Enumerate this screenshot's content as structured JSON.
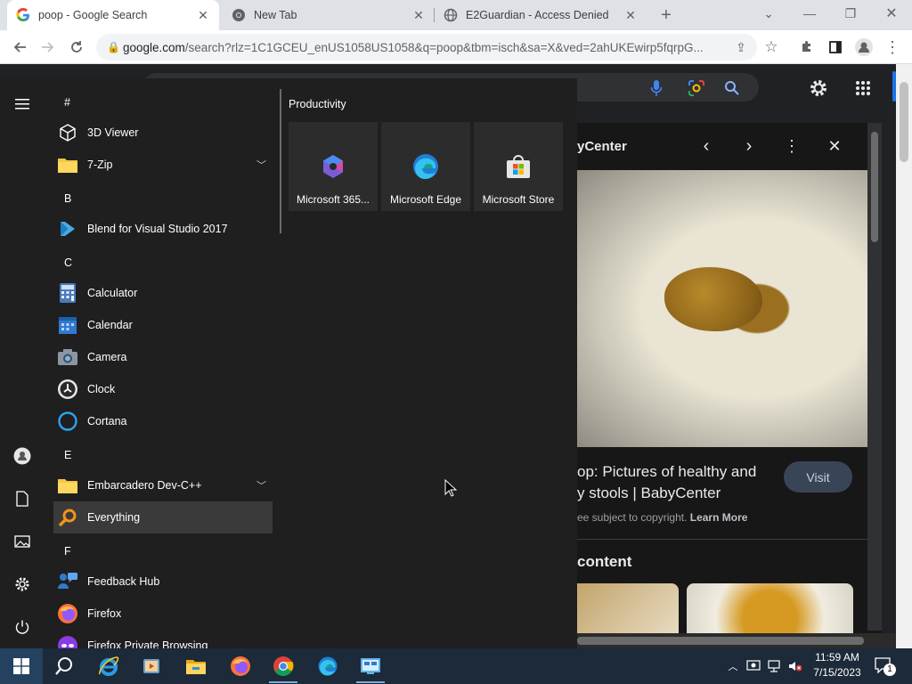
{
  "browser": {
    "tabs": [
      {
        "title": "poop - Google Search",
        "active": true,
        "icon": "google-icon"
      },
      {
        "title": "New Tab",
        "active": false,
        "icon": "chrome-icon"
      },
      {
        "title": "E2Guardian - Access Denied",
        "active": false,
        "icon": "globe-icon"
      }
    ],
    "new_tab_symbol": "+",
    "address": {
      "host": "google.com",
      "path": "/search?rlz=1C1GCEU_enUS1058US1058&q=poop&tbm=isch&sa=X&ved=2ahUKEwirp5fqrpG..."
    }
  },
  "google": {
    "preview": {
      "source": "yCenter",
      "title_line1": "op: Pictures of healthy and",
      "title_line2": "y stools | BabyCenter",
      "visit_label": "Visit",
      "copyright": "ee subject to copyright.",
      "learn_more": "Learn More",
      "related_heading": "content"
    }
  },
  "start_menu": {
    "apps": [
      {
        "type": "letter",
        "label": "#"
      },
      {
        "type": "app",
        "label": "3D Viewer",
        "icon": "3d-viewer-icon"
      },
      {
        "type": "app",
        "label": "7-Zip",
        "icon": "folder-icon",
        "expandable": true
      },
      {
        "type": "letter",
        "label": "B"
      },
      {
        "type": "app",
        "label": "Blend for Visual Studio 2017",
        "icon": "blend-icon"
      },
      {
        "type": "letter",
        "label": "C"
      },
      {
        "type": "app",
        "label": "Calculator",
        "icon": "calculator-icon"
      },
      {
        "type": "app",
        "label": "Calendar",
        "icon": "calendar-icon"
      },
      {
        "type": "app",
        "label": "Camera",
        "icon": "camera-icon"
      },
      {
        "type": "app",
        "label": "Clock",
        "icon": "clock-icon"
      },
      {
        "type": "app",
        "label": "Cortana",
        "icon": "cortana-icon"
      },
      {
        "type": "letter",
        "label": "E"
      },
      {
        "type": "app",
        "label": "Embarcadero Dev-C++",
        "icon": "folder-icon",
        "expandable": true
      },
      {
        "type": "app",
        "label": "Everything",
        "icon": "everything-search-icon",
        "highlighted": true
      },
      {
        "type": "letter",
        "label": "F"
      },
      {
        "type": "app",
        "label": "Feedback Hub",
        "icon": "feedback-hub-icon"
      },
      {
        "type": "app",
        "label": "Firefox",
        "icon": "firefox-icon"
      },
      {
        "type": "app",
        "label": "Firefox Private Browsing",
        "icon": "firefox-private-icon"
      }
    ],
    "group_name": "Productivity",
    "tiles": [
      {
        "label": "Microsoft 365...",
        "icon": "microsoft-365-icon"
      },
      {
        "label": "Microsoft Edge",
        "icon": "edge-icon"
      },
      {
        "label": "Microsoft Store",
        "icon": "store-icon"
      }
    ]
  },
  "taskbar": {
    "time": "11:59 AM",
    "date": "7/15/2023",
    "notification_count": "1"
  }
}
